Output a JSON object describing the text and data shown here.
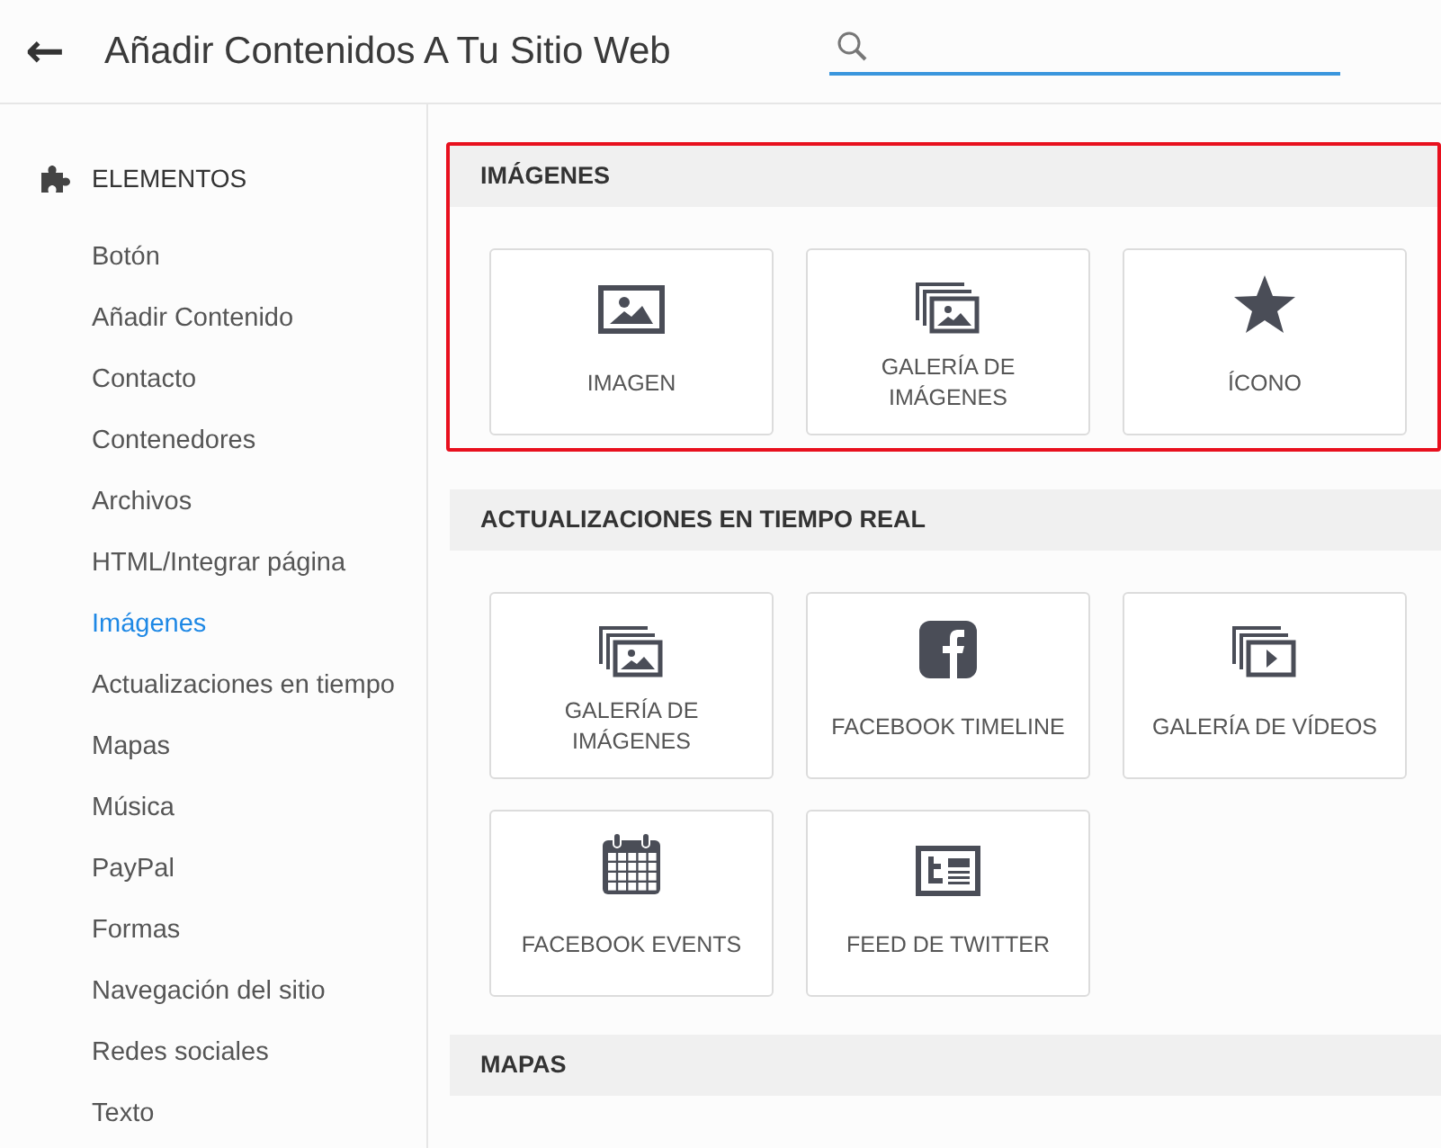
{
  "header": {
    "back": "←",
    "title": "Añadir Contenidos A Tu Sitio Web"
  },
  "sidebar": {
    "heading": "ELEMENTOS",
    "items": [
      {
        "label": "Botón",
        "selected": false
      },
      {
        "label": "Añadir Contenido",
        "selected": false
      },
      {
        "label": "Contacto",
        "selected": false
      },
      {
        "label": "Contenedores",
        "selected": false
      },
      {
        "label": "Archivos",
        "selected": false
      },
      {
        "label": "HTML/Integrar página",
        "selected": false
      },
      {
        "label": "Imágenes",
        "selected": true
      },
      {
        "label": "Actualizaciones en tiempo",
        "selected": false
      },
      {
        "label": "Mapas",
        "selected": false
      },
      {
        "label": "Música",
        "selected": false
      },
      {
        "label": "PayPal",
        "selected": false
      },
      {
        "label": "Formas",
        "selected": false
      },
      {
        "label": "Navegación del sitio",
        "selected": false
      },
      {
        "label": "Redes sociales",
        "selected": false
      },
      {
        "label": "Texto",
        "selected": false
      }
    ]
  },
  "sections": [
    {
      "title": "IMÁGENES",
      "highlighted": true,
      "tiles": [
        {
          "kind": "image",
          "label": "IMAGEN"
        },
        {
          "kind": "gallery",
          "label": "GALERÍA DE IMÁGENES"
        },
        {
          "kind": "star",
          "label": "ÍCONO"
        }
      ]
    },
    {
      "title": "ACTUALIZACIONES EN TIEMPO REAL",
      "highlighted": false,
      "tiles": [
        {
          "kind": "gallery",
          "label": "GALERÍA DE IMÁGENES"
        },
        {
          "kind": "facebook",
          "label": "FACEBOOK TIMELINE"
        },
        {
          "kind": "video",
          "label": "GALERÍA DE VÍDEOS"
        },
        {
          "kind": "calendar",
          "label": "FACEBOOK EVENTS"
        },
        {
          "kind": "twitter",
          "label": "FEED DE TWITTER"
        }
      ]
    },
    {
      "title": "MAPAS",
      "highlighted": false
    }
  ]
}
